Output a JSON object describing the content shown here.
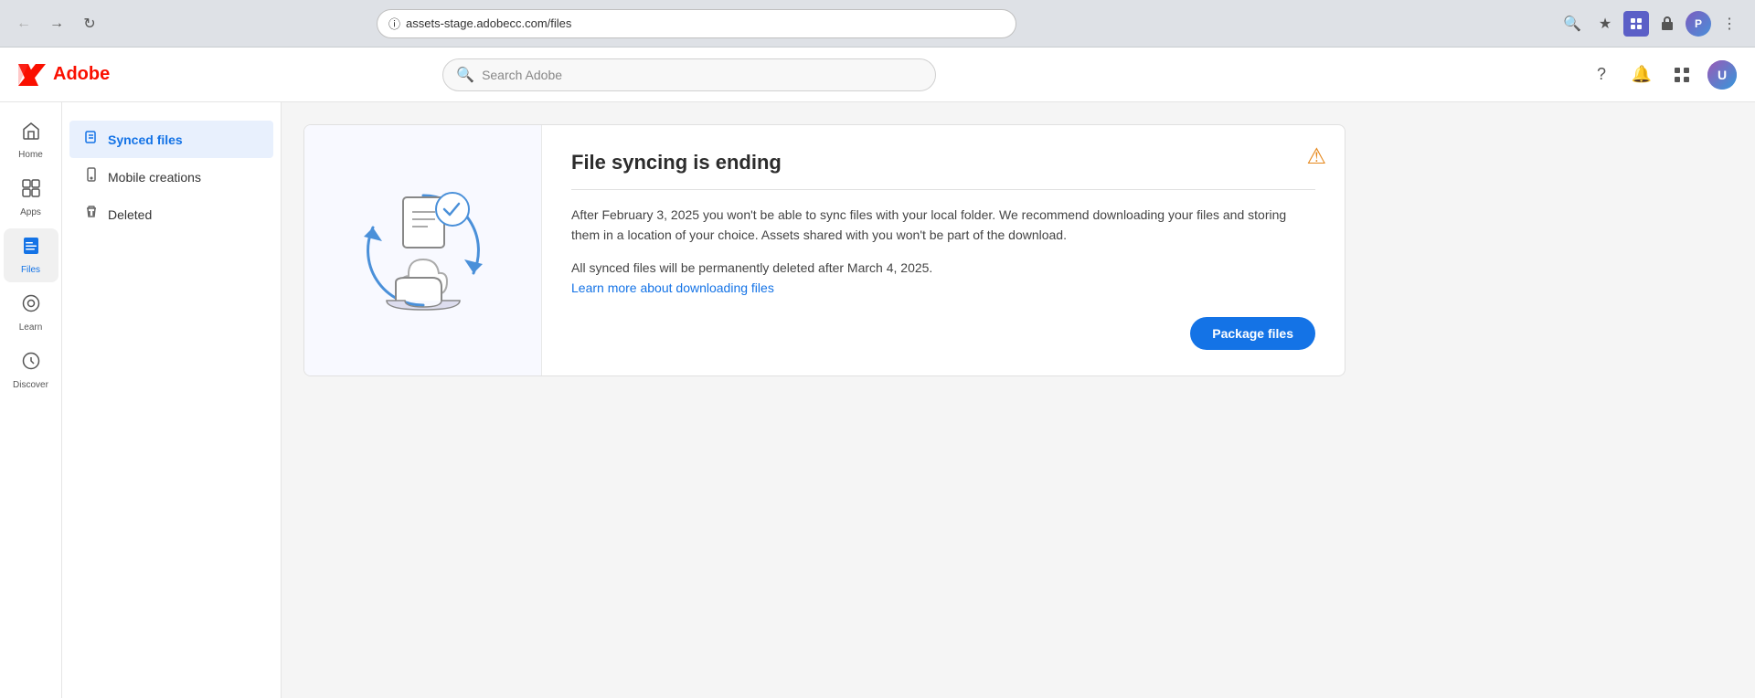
{
  "browser": {
    "url": "assets-stage.adobecc.com/files",
    "back_disabled": true,
    "forward_disabled": true,
    "search_placeholder": "Search Adobe"
  },
  "header": {
    "logo_text": "Adobe",
    "search_placeholder": "Search Adobe",
    "help_label": "Help",
    "notifications_label": "Notifications",
    "apps_label": "Apps",
    "avatar_label": "User Avatar"
  },
  "sidebar": {
    "items": [
      {
        "id": "home",
        "label": "Home",
        "icon": "⌂",
        "active": false
      },
      {
        "id": "apps",
        "label": "Apps",
        "icon": "⊞",
        "active": false
      },
      {
        "id": "files",
        "label": "Files",
        "icon": "□",
        "active": true
      },
      {
        "id": "learn",
        "label": "Learn",
        "icon": "◎",
        "active": false
      },
      {
        "id": "discover",
        "label": "Discover",
        "icon": "◎",
        "active": false
      }
    ]
  },
  "sub_sidebar": {
    "items": [
      {
        "id": "synced-files",
        "label": "Synced files",
        "icon": "📄",
        "active": true
      },
      {
        "id": "mobile-creations",
        "label": "Mobile creations",
        "icon": "📱",
        "active": false
      },
      {
        "id": "deleted",
        "label": "Deleted",
        "icon": "🗑",
        "active": false
      }
    ]
  },
  "banner": {
    "title": "File syncing is ending",
    "divider": true,
    "body_text": "After February 3, 2025 you won't be able to sync files with your local folder. We recommend downloading your files and storing them in a location of your choice. Assets shared with you won't be part of the download.",
    "secondary_text": "All synced files will be permanently deleted after March 4, 2025.",
    "learn_link_text": "Learn more about downloading files",
    "learn_link_href": "#",
    "package_button_label": "Package files",
    "warning_icon": "⚠"
  }
}
